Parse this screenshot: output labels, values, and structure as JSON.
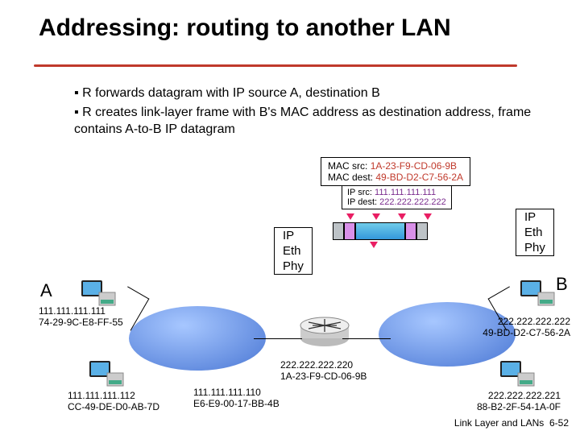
{
  "title": "Addressing: routing to another LAN",
  "bullets": [
    "R forwards datagram with IP source A, destination B",
    "R creates link-layer frame with B's MAC address as destination address, frame contains A-to-B IP datagram"
  ],
  "mac": {
    "src_label": "MAC src:",
    "src_val": "1A-23-F9-CD-06-9B",
    "dst_label": "MAC dest:",
    "dst_val": "49-BD-D2-C7-56-2A"
  },
  "ip_hdr": {
    "src_label": "IP src:",
    "src_val": "111.111.111.111",
    "dst_label": "IP dest:",
    "dst_val": "222.222.222.222"
  },
  "stack": {
    "ip": "IP",
    "eth": "Eth",
    "phy": "Phy"
  },
  "nodes": {
    "A_label": "A",
    "B_label": "B",
    "host_a": {
      "ip": "111.111.111.111",
      "mac": "74-29-9C-E8-FF-55"
    },
    "host_a2": {
      "ip": "111.111.111.112",
      "mac": "CC-49-DE-D0-AB-7D"
    },
    "router_left": {
      "ip": "111.111.111.110",
      "mac": "E6-E9-00-17-BB-4B"
    },
    "router_right": {
      "ip": "222.222.222.220",
      "mac": "1A-23-F9-CD-06-9B"
    },
    "host_b": {
      "ip": "222.222.222.222",
      "mac": "49-BD-D2-C7-56-2A"
    },
    "host_b2": {
      "ip": "222.222.222.221",
      "mac": "88-B2-2F-54-1A-0F"
    }
  },
  "footer": {
    "text": "Link Layer and LANs",
    "page": "6-52"
  }
}
